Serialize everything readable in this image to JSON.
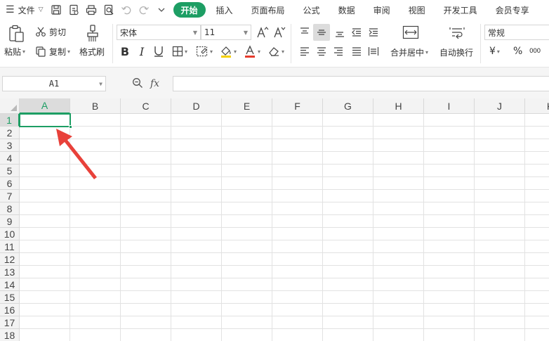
{
  "menu": {
    "file_label": "文件",
    "tabs": [
      {
        "label": "开始",
        "active": true
      },
      {
        "label": "插入",
        "active": false
      },
      {
        "label": "页面布局",
        "active": false
      },
      {
        "label": "公式",
        "active": false
      },
      {
        "label": "数据",
        "active": false
      },
      {
        "label": "审阅",
        "active": false
      },
      {
        "label": "视图",
        "active": false
      },
      {
        "label": "开发工具",
        "active": false
      },
      {
        "label": "会员专享",
        "active": false
      }
    ]
  },
  "ribbon": {
    "paste_label": "粘贴",
    "cut_label": "剪切",
    "copy_label": "复制",
    "format_painter_label": "格式刷",
    "font_name": "宋体",
    "font_size": "11",
    "merge_label": "合并居中",
    "wrap_label": "自动换行",
    "number_format": "常规",
    "currency_symbol": "¥",
    "percent_symbol": "%",
    "thousands_symbol": "000"
  },
  "formula_bar": {
    "name_box": "A1",
    "fx_label": "fx",
    "formula": ""
  },
  "sheet": {
    "columns": [
      "A",
      "B",
      "C",
      "D",
      "E",
      "F",
      "G",
      "H",
      "I",
      "J",
      "K"
    ],
    "rows": [
      "1",
      "2",
      "3",
      "4",
      "5",
      "6",
      "7",
      "8",
      "9",
      "10",
      "11",
      "12",
      "13",
      "14",
      "15",
      "16",
      "17",
      "18"
    ],
    "selected_cell": "A1"
  },
  "colors": {
    "accent": "#1d9e64",
    "annotation_arrow": "#e8413a"
  }
}
